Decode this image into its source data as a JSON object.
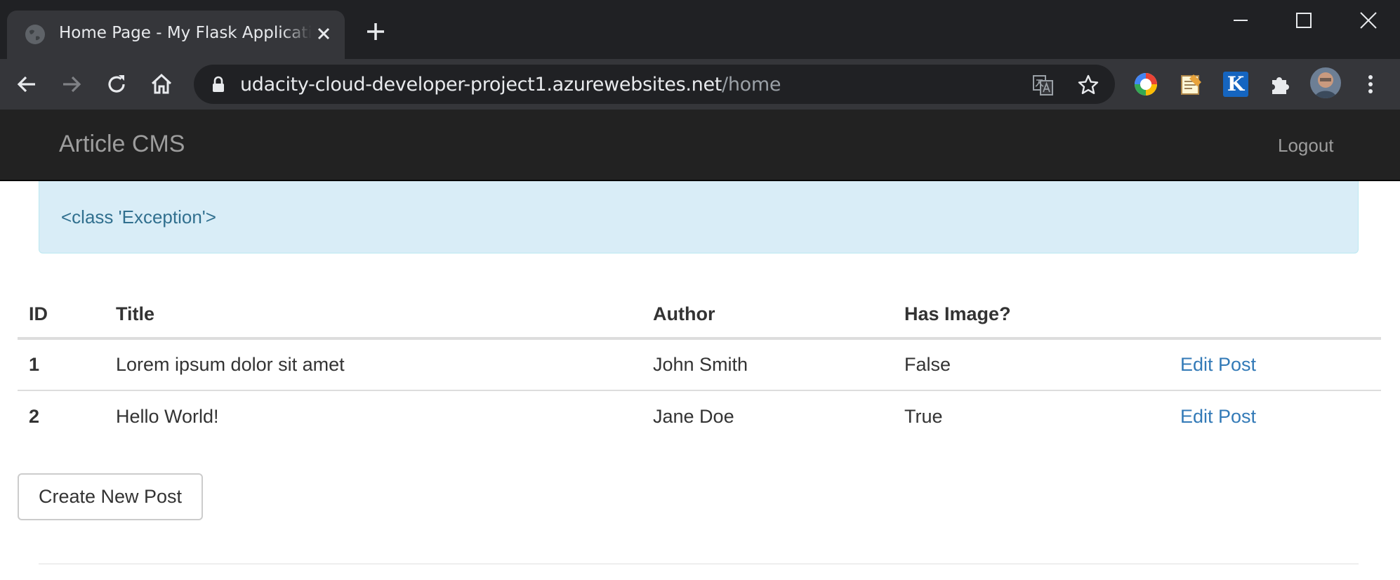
{
  "browser": {
    "tab_title": "Home Page - My Flask Application",
    "url_host": "udacity-cloud-developer-project1.azurewebsites.net",
    "url_path": "/home"
  },
  "navbar": {
    "brand": "Article CMS",
    "logout_label": "Logout"
  },
  "alert": {
    "message": "<class 'Exception'>"
  },
  "table": {
    "headers": [
      "ID",
      "Title",
      "Author",
      "Has Image?",
      ""
    ],
    "rows": [
      {
        "id": "1",
        "title": "Lorem ipsum dolor sit amet",
        "author": "John Smith",
        "has_image": "False",
        "action": "Edit Post"
      },
      {
        "id": "2",
        "title": "Hello World!",
        "author": "Jane Doe",
        "has_image": "True",
        "action": "Edit Post"
      }
    ]
  },
  "create_button_label": "Create New Post",
  "extension_k_label": "K",
  "colors": {
    "navbar_bg": "#222222",
    "alert_bg": "#d9edf7",
    "alert_text": "#31708f",
    "link": "#337ab7"
  }
}
